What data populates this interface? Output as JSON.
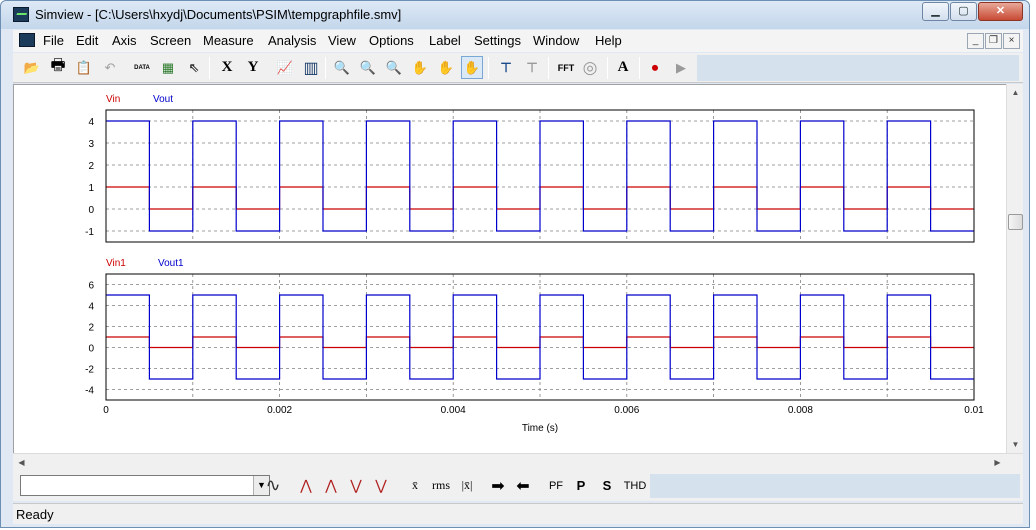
{
  "window": {
    "title": "Simview - [C:\\Users\\hxydj\\Documents\\PSIM\\tempgraphfile.smv]",
    "buttons": {
      "minimize": "▁",
      "maximize": "▢",
      "close": "✕"
    }
  },
  "menu": {
    "items": [
      "File",
      "Edit",
      "Axis",
      "Screen",
      "Measure",
      "Analysis",
      "View",
      "Options",
      "Label",
      "Settings",
      "Window",
      "Help"
    ],
    "mdi_buttons": {
      "minimize": "_",
      "restore": "❐",
      "close": "×"
    }
  },
  "toolbar": {
    "tools": [
      {
        "id": "open",
        "icon": "open-folder-icon",
        "glyph": "📂"
      },
      {
        "id": "print",
        "icon": "printer-icon",
        "glyph": "🖶"
      },
      {
        "id": "copy",
        "icon": "clipboard-icon",
        "glyph": "📋"
      },
      {
        "id": "undo",
        "icon": "undo-icon",
        "glyph": "↶"
      },
      {
        "id": "data",
        "icon": "data-icon",
        "glyph": "DATA"
      },
      {
        "id": "plot",
        "icon": "plot-select-icon",
        "glyph": "▦"
      },
      {
        "id": "pointer",
        "icon": "pointer-icon",
        "glyph": "⇖"
      },
      {
        "id": "x",
        "icon": "x-axis-icon",
        "glyph": "X"
      },
      {
        "id": "y",
        "icon": "y-axis-icon",
        "glyph": "Y"
      },
      {
        "id": "graph",
        "icon": "graph-icon",
        "glyph": "📈"
      },
      {
        "id": "screen",
        "icon": "screen-icon",
        "glyph": "▥"
      },
      {
        "id": "zoom",
        "icon": "zoom-icon",
        "glyph": "🔍"
      },
      {
        "id": "zoom_in",
        "icon": "zoom-in-icon",
        "glyph": "🔍"
      },
      {
        "id": "zoom_out",
        "icon": "zoom-out-icon",
        "glyph": "🔍"
      },
      {
        "id": "pan1",
        "icon": "hand-icon",
        "glyph": "✋"
      },
      {
        "id": "pan2",
        "icon": "hand-icon",
        "glyph": "✋"
      },
      {
        "id": "pan3",
        "icon": "hand-icon",
        "glyph": "✋"
      },
      {
        "id": "measure",
        "icon": "measure-icon",
        "glyph": "⊤"
      },
      {
        "id": "measure2",
        "icon": "measure-icon",
        "glyph": "⊤"
      },
      {
        "id": "fft",
        "icon": "fft-icon",
        "glyph": "FFT"
      },
      {
        "id": "disc",
        "icon": "disc-icon",
        "glyph": "◎"
      },
      {
        "id": "text",
        "icon": "text-icon",
        "glyph": "A"
      },
      {
        "id": "record",
        "icon": "record-icon",
        "glyph": "⏺"
      },
      {
        "id": "play",
        "icon": "play-icon",
        "glyph": "▶"
      }
    ]
  },
  "bottom_toolbar": {
    "combo_value": "",
    "buttons": [
      {
        "id": "sine",
        "label": "∿"
      },
      {
        "id": "max",
        "label": "⋀"
      },
      {
        "id": "min",
        "label": "⋁"
      },
      {
        "id": "avg",
        "label": "x̄"
      },
      {
        "id": "rms",
        "label": "rms"
      },
      {
        "id": "absavg",
        "label": "|x̄|"
      },
      {
        "id": "next",
        "label": "➡"
      },
      {
        "id": "prev",
        "label": "⬅"
      },
      {
        "id": "pf",
        "label": "PF"
      },
      {
        "id": "p",
        "label": "P"
      },
      {
        "id": "s",
        "label": "S"
      },
      {
        "id": "thd",
        "label": "THD"
      }
    ]
  },
  "status": {
    "text": "Ready"
  },
  "colors": {
    "red_trace": "#cc0000",
    "blue_trace": "#0000cc",
    "grid": "#808080"
  },
  "chart_data": [
    {
      "type": "line",
      "title": "",
      "xlabel": "",
      "ylabel": "",
      "xlim": [
        0,
        0.01
      ],
      "ylim": [
        -1.5,
        4.5
      ],
      "yticks": [
        -1,
        0,
        1,
        2,
        3,
        4
      ],
      "legend_placement": "top-left",
      "series": [
        {
          "name": "Vin",
          "color": "#cc0000",
          "low": 0,
          "high": 1,
          "period": 0.001,
          "duty": 0.5
        },
        {
          "name": "Vout",
          "color": "#0000cc",
          "low": -1,
          "high": 4,
          "period": 0.001,
          "duty": 0.5
        }
      ]
    },
    {
      "type": "line",
      "title": "",
      "xlabel": "Time (s)",
      "ylabel": "",
      "xlim": [
        0,
        0.01
      ],
      "ylim": [
        -5,
        7
      ],
      "yticks": [
        -4,
        -2,
        0,
        2,
        4,
        6
      ],
      "xticks": [
        "0",
        "0.002",
        "0.004",
        "0.006",
        "0.008",
        "0.01"
      ],
      "legend_placement": "top-left",
      "series": [
        {
          "name": "Vin1",
          "color": "#cc0000",
          "low": 0,
          "high": 1,
          "period": 0.001,
          "duty": 0.5
        },
        {
          "name": "Vout1",
          "color": "#0000cc",
          "low": -3,
          "high": 5,
          "period": 0.001,
          "duty": 0.5
        }
      ]
    }
  ]
}
